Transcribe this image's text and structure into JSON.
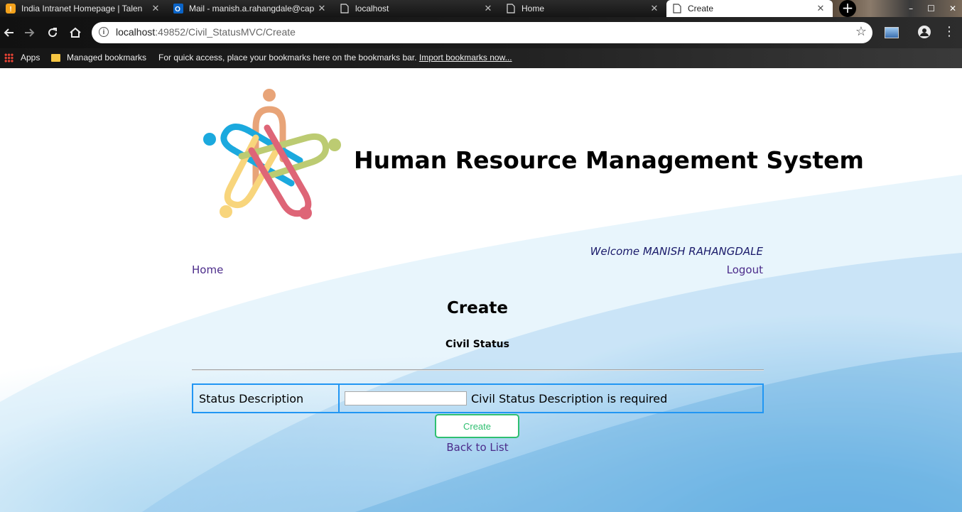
{
  "browser": {
    "tabs": [
      {
        "title": "India Intranet Homepage | Talen",
        "icon": "intranet-icon",
        "active": false
      },
      {
        "title": "Mail - manish.a.rahangdale@cap",
        "icon": "outlook-icon",
        "active": false
      },
      {
        "title": "localhost",
        "icon": "page-icon",
        "active": false
      },
      {
        "title": "Home",
        "icon": "page-icon",
        "active": false
      },
      {
        "title": "Create",
        "icon": "page-icon",
        "active": true
      }
    ],
    "close_glyph": "✕",
    "new_tab_glyph": "+",
    "url_host": "localhost",
    "url_path": ":49852/Civil_StatusMVC/Create",
    "bookmarks": {
      "apps": "Apps",
      "managed": "Managed bookmarks",
      "hint": "For quick access, place your bookmarks here on the bookmarks bar.",
      "import": "Import bookmarks now..."
    }
  },
  "header": {
    "site_title": "Human Resource Management System",
    "welcome": "Welcome MANISH RAHANGDALE",
    "home": "Home",
    "logout": "Logout"
  },
  "main": {
    "heading": "Create",
    "section": "Civil Status",
    "form": {
      "label": "Status Description",
      "value": "",
      "placeholder": "",
      "validation": "Civil Status Description is required"
    },
    "create_button": "Create",
    "back_link": "Back to List"
  },
  "colors": {
    "accent": "#2196f3",
    "button_green": "#2fbf71",
    "link": "#4b2b8a"
  }
}
